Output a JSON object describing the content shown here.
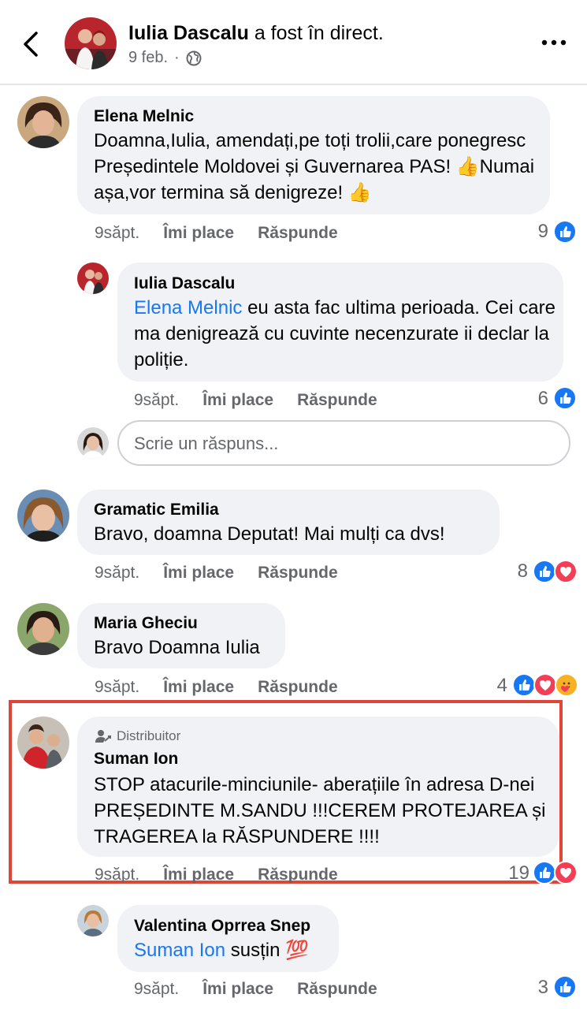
{
  "header": {
    "name": "Iulia Dascalu",
    "action": "a fost în direct.",
    "date": "9 feb.",
    "separator": "·"
  },
  "comments": [
    {
      "author": "Elena Melnic",
      "text": "Doamna,Iulia, amendați,pe toți trolii,care ponegresc Președintele Moldovei și Guvernarea PAS! 👍Numai așa,vor termina să denigreze! 👍",
      "time": "9săpt.",
      "like_label": "Îmi place",
      "reply_label": "Răspunde",
      "count": "9",
      "reactions": [
        "like"
      ]
    },
    {
      "author": "Iulia Dascalu",
      "mention": "Elena Melnic",
      "text": " eu asta fac ultima perioada. Cei care ma denigrează cu cuvinte necenzurate ii declar la poliție.",
      "time": "9săpt.",
      "like_label": "Îmi place",
      "reply_label": "Răspunde",
      "count": "6",
      "reactions": [
        "like"
      ]
    },
    {
      "author": "Gramatic Emilia",
      "text": "Bravo, doamna  Deputat! Mai mulți  ca dvs!",
      "time": "9săpt.",
      "like_label": "Îmi place",
      "reply_label": "Răspunde",
      "count": "8",
      "reactions": [
        "like",
        "love"
      ]
    },
    {
      "author": "Maria Gheciu",
      "text": "Bravo Doamna Iulia",
      "time": "9săpt.",
      "like_label": "Îmi place",
      "reply_label": "Răspunde",
      "count": "4",
      "reactions": [
        "like",
        "love",
        "care"
      ]
    },
    {
      "badge": "Distribuitor",
      "author": "Suman Ion",
      "text": "STOP atacurile-minciunile- aberațiile în adresa D-nei PREȘEDINTE M.SANDU !!!CEREM PROTEJAREA și TRAGEREA la RĂSPUNDERE !!!!",
      "time": "9săpt.",
      "like_label": "Îmi place",
      "reply_label": "Răspunde",
      "count": "19",
      "reactions": [
        "like",
        "love"
      ]
    },
    {
      "author": "Valentina Oprrea Snep",
      "mention": "Suman Ion",
      "text": " susțin 💯",
      "time": "9săpt.",
      "like_label": "Îmi place",
      "reply_label": "Răspunde",
      "count": "3",
      "reactions": [
        "like"
      ]
    }
  ],
  "reply_box": {
    "placeholder": "Scrie un răspuns..."
  },
  "colors": {
    "accent": "#1877f2",
    "bubble": "#f0f2f5",
    "secondary_text": "#65676b",
    "highlight": "#e0453a"
  }
}
